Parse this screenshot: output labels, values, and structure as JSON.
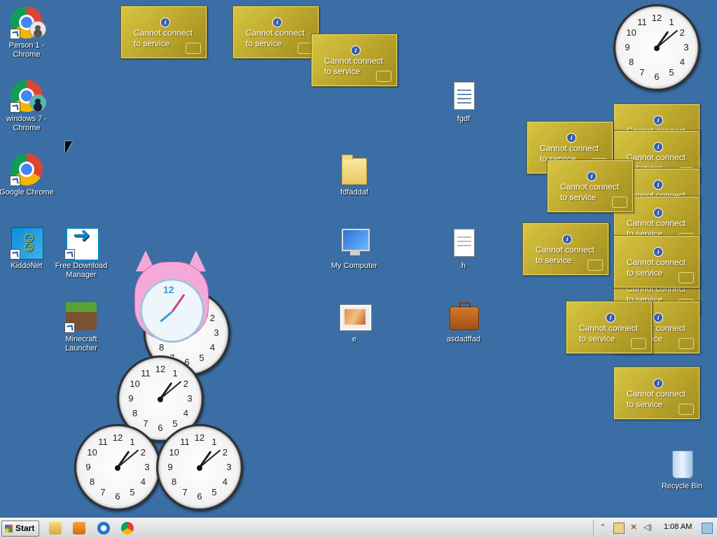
{
  "desktop": {
    "icons": [
      {
        "label": "Person 1 - Chrome",
        "icon": "chrome-icon"
      },
      {
        "label": "windows 7 - Chrome",
        "icon": "chrome-icon"
      },
      {
        "label": "Google Chrome",
        "icon": "chrome-icon"
      },
      {
        "label": "KiddoNet",
        "icon": "kiddonet-icon"
      },
      {
        "label": "Free Download Manager",
        "icon": "fdm-icon"
      },
      {
        "label": "Minecraft Launcher",
        "icon": "minecraft-icon"
      },
      {
        "label": "fdfaddaf",
        "icon": "folder-icon"
      },
      {
        "label": "My Computer",
        "icon": "computer-icon"
      },
      {
        "label": "e",
        "icon": "image-file-icon"
      },
      {
        "label": "fgdf",
        "icon": "document-icon"
      },
      {
        "label": "h",
        "icon": "text-file-icon"
      },
      {
        "label": "asdadffad",
        "icon": "briefcase-icon"
      },
      {
        "label": "Recycle Bin",
        "icon": "recycle-bin-icon"
      }
    ]
  },
  "gadget": {
    "message": "Cannot connect to service",
    "info_symbol": "i",
    "color": "#c8b43a"
  },
  "clock": {
    "numbers": [
      "12",
      "1",
      "2",
      "3",
      "4",
      "5",
      "6",
      "7",
      "8",
      "9",
      "10",
      "11"
    ]
  },
  "taskbar": {
    "start_label": "Start",
    "time": "1:08 AM",
    "tray_icons": [
      "show-hidden-icons-icon",
      "action-center-icon",
      "network-icon",
      "volume-icon"
    ]
  },
  "colors": {
    "desktop": "#3a6ea5",
    "taskbar": "#dcdcdc"
  }
}
